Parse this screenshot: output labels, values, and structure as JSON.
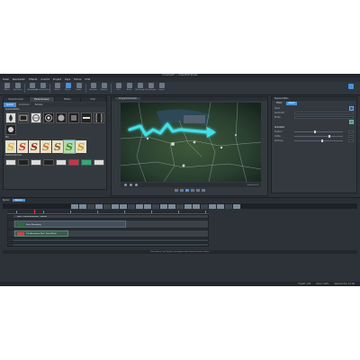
{
  "window": {
    "title": "Unnamed* — VideoEdit Studio"
  },
  "menu": [
    "Datei",
    "Bearbeiten",
    "Effekte",
    "Ansicht",
    "Projekt",
    "Clips",
    "Extras",
    "Hilfe"
  ],
  "toolbar": {
    "buttons": [
      "Öffnen",
      "Speichern",
      "Rückgängig",
      "Wiederherstellen",
      "Schnitt",
      "Effekte",
      "Export",
      "Vorschau",
      "Rendern",
      "Titel",
      "Audio",
      "Werkzeuge",
      "Einstellungen",
      "Layout"
    ],
    "right_label": "Optionen"
  },
  "left_panel": {
    "tabs": [
      "Medienbrowser",
      "Medienbrowser",
      "Effekte",
      "Filter"
    ],
    "subtabs": [
      "Spezial",
      "Intro/Outro",
      "Bildstile"
    ],
    "section1": "Spezialeffekte",
    "section2": "Stil",
    "section3": "Textanimationen"
  },
  "center": {
    "tab": "Programmmonitor",
    "timecode": "00:00:05:12"
  },
  "right_panel": {
    "header": "Eigenschaften",
    "tabs": [
      "Effekt",
      "Objekt"
    ],
    "props": [
      {
        "label": "Farbe"
      },
      {
        "label": "Deckkraft"
      },
      {
        "label": "Breite"
      }
    ],
    "section": "Animation",
    "props2": [
      {
        "label": "Position"
      },
      {
        "label": "Größe"
      },
      {
        "label": "Drehung"
      }
    ]
  },
  "timeline": {
    "tabs": [
      "Spuren",
      "Szenen"
    ],
    "track1_label": "Spur 1 Kartenanimation - Spezial",
    "clip_video": "Karte Bewegung",
    "clip_title": "Titel Animation Pfeil / Karte/Effekt",
    "footer": "Hier klicken, um Objekte einzufügen oder Dateien hierher ziehen"
  },
  "status": [
    "Projekt: 1/32",
    "Zoom: 100%",
    "Speicher frei: 4,2 GB"
  ],
  "colors": {
    "accent": "#4a90d9",
    "arrow": "#3fe0e8"
  }
}
